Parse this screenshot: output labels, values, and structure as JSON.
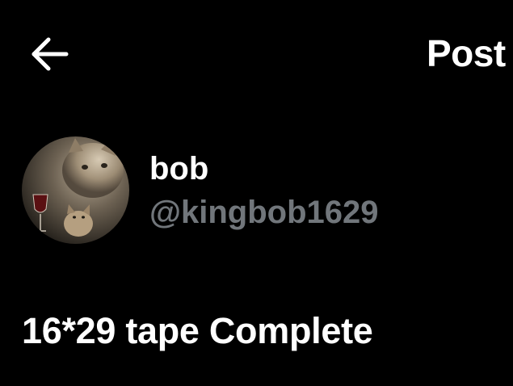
{
  "header": {
    "back_icon": "arrow-left-icon",
    "title": "Post"
  },
  "author": {
    "display_name": "bob",
    "handle": "@kingbob1629",
    "avatar": "cat-with-wine-glass-avatar"
  },
  "post": {
    "text": "16*29 tape Complete"
  },
  "colors": {
    "background": "#000000",
    "primary_text": "#ffffff",
    "secondary_text": "#71767b"
  }
}
